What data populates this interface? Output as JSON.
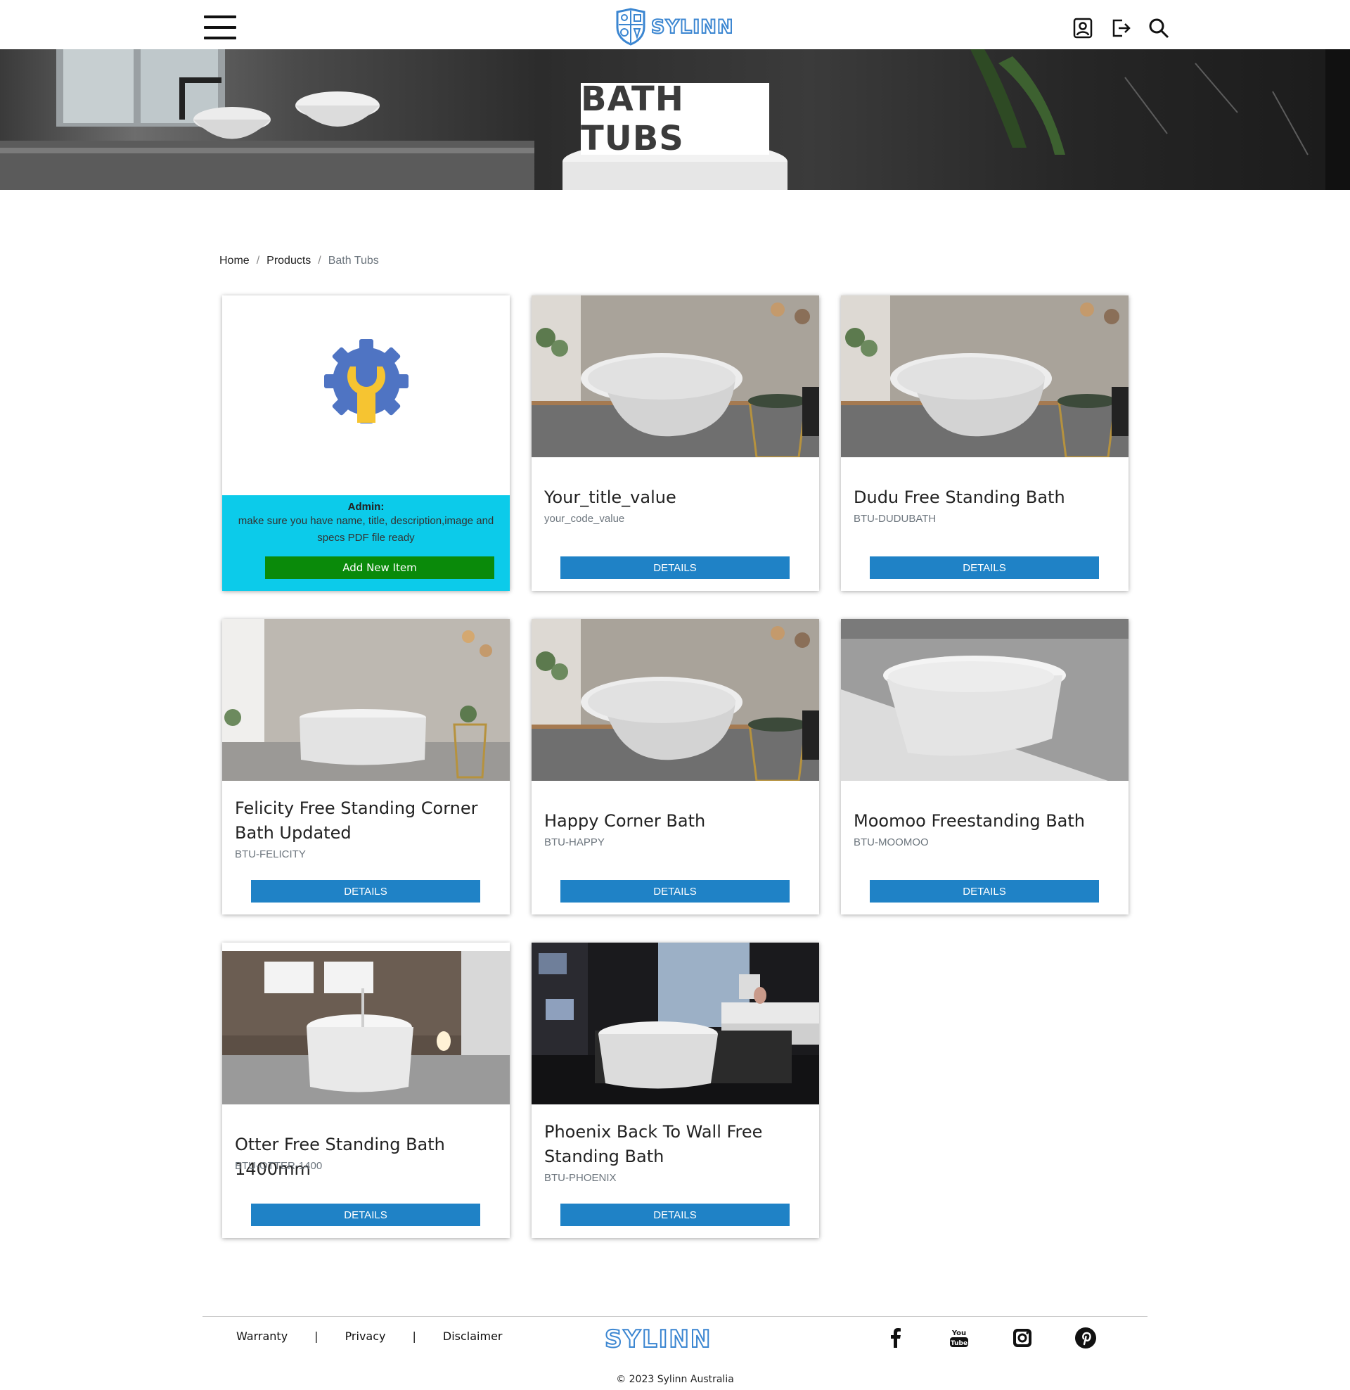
{
  "header": {
    "brand": "SYLINN",
    "hero_title": "BATH TUBS"
  },
  "breadcrumb": {
    "home": "Home",
    "products": "Products",
    "current": "Bath Tubs",
    "separator": "/"
  },
  "admin_card": {
    "label": "Admin:",
    "text": "make sure you have name, title, description,image and specs PDF file ready",
    "button": "Add New Item"
  },
  "products": [
    {
      "title": "Your_title_value",
      "code": "your_code_value",
      "button": "DETAILS"
    },
    {
      "title": "Dudu Free Standing Bath",
      "code": "BTU-DUDUBATH",
      "button": "DETAILS"
    },
    {
      "title": "Felicity Free Standing Corner Bath Updated",
      "code": "BTU-FELICITY",
      "button": "DETAILS"
    },
    {
      "title": "Happy Corner Bath",
      "code": "BTU-HAPPY",
      "button": "DETAILS"
    },
    {
      "title": "Moomoo Freestanding Bath",
      "code": "BTU-MOOMOO",
      "button": "DETAILS"
    },
    {
      "title": "Otter Free Standing Bath 1400mm",
      "code": "BTU-OTTER-1400",
      "button": "DETAILS"
    },
    {
      "title": "Phoenix Back To Wall Free Standing Bath",
      "code": "BTU-PHOENIX",
      "button": "DETAILS"
    }
  ],
  "footer": {
    "links": [
      "Warranty",
      "Privacy",
      "Disclaimer"
    ],
    "separator": "|",
    "logo": "SYLINN",
    "copyright": "© 2023 Sylinn Australia"
  },
  "colors": {
    "primary_button": "#1f82c6",
    "admin_panel": "#0ccbea",
    "add_button": "#0a8a0a",
    "brand": "#3b86d1"
  },
  "icons": {
    "header": [
      "menu-icon",
      "account-icon",
      "logout-icon",
      "search-icon"
    ],
    "social": [
      "facebook-icon",
      "youtube-icon",
      "instagram-icon",
      "pinterest-icon"
    ]
  }
}
